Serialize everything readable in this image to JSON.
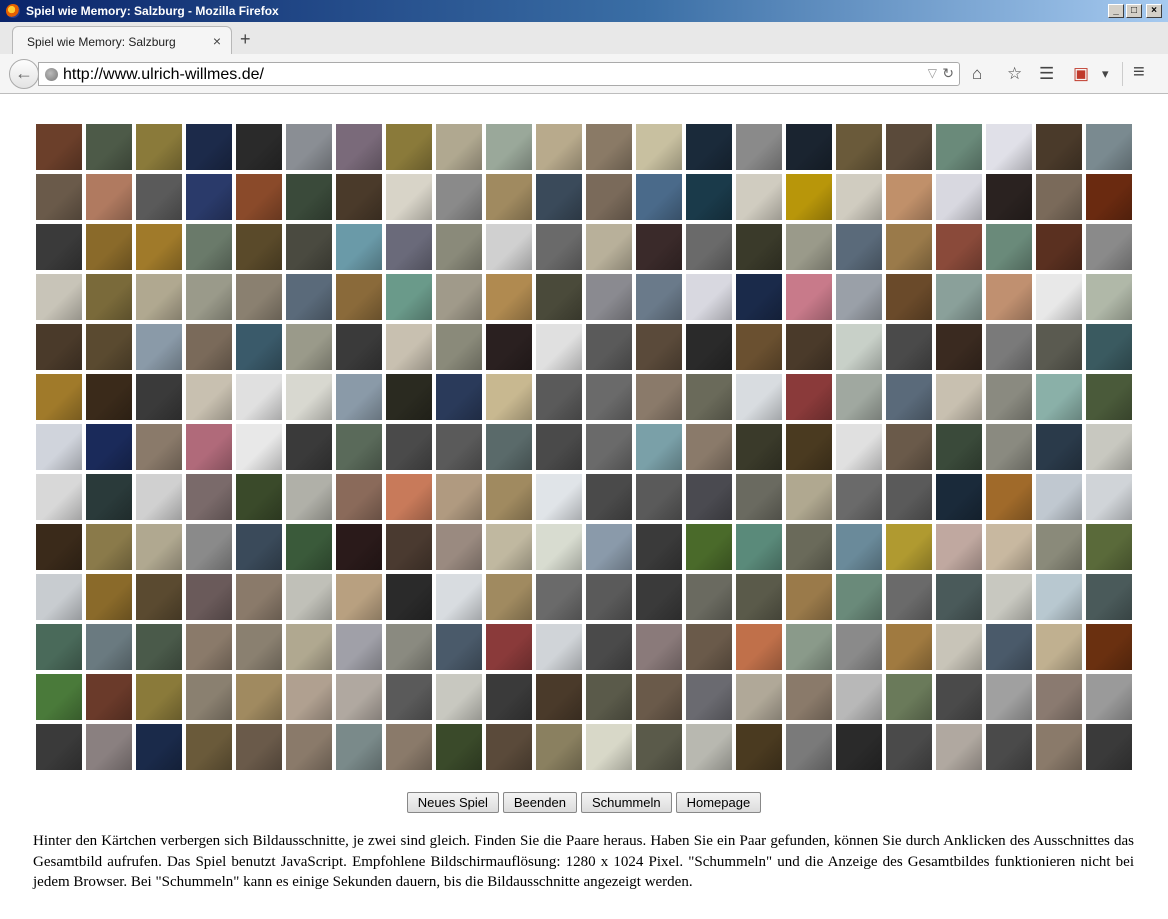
{
  "window": {
    "title": "Spiel wie Memory: Salzburg - Mozilla Firefox",
    "controls": [
      "_",
      "□",
      "×"
    ]
  },
  "tab": {
    "label": "Spiel wie Memory: Salzburg",
    "close": "×",
    "new_tab": "+"
  },
  "navbar": {
    "back": "←",
    "url": "http://www.ulrich-willmes.de/",
    "dropdown": "▽",
    "reload": "↻",
    "icons": {
      "home": "⌂",
      "bookmark": "☆",
      "reading": "☰",
      "pocket": "▣",
      "menu": "≡",
      "more": "▾"
    }
  },
  "game": {
    "columns": 22,
    "rows": 13,
    "tile_colors": [
      "#6b3f2a",
      "#4d5a48",
      "#8a7a3a",
      "#1c2a4a",
      "#2a2a2a",
      "#8a8e94",
      "#7a6a7a",
      "#8a7a3a",
      "#b0a890",
      "#9aa89a",
      "#b8aa8c",
      "#8a7a66",
      "#c8c0a0",
      "#1a2a3a",
      "#8a8a8a",
      "#1a2430",
      "#6a5a3a",
      "#5a4a3a",
      "#6a8a7a",
      "#e0e0e8",
      "#4a3a2a",
      "#7a8a90",
      "#6a5a4a",
      "#b07a60",
      "#5a5a5a",
      "#2a3a6a",
      "#8a4a2a",
      "#3a4a3a",
      "#4a3a2a",
      "#d8d4c8",
      "#8a8a8a",
      "#a08a60",
      "#3a4a5a",
      "#7a6a5a",
      "#4a6a8a",
      "#1a3a4a",
      "#d0ccc0",
      "#b8960a",
      "#d0ccc0",
      "#c0906a",
      "#d8d8e0",
      "#2a2220",
      "#7a6a5a",
      "#6a2a10",
      "#3a3a3a",
      "#8a6a2a",
      "#a07a2a",
      "#6a7a6a",
      "#5a4a2a",
      "#4a4a40",
      "#6a9aa8",
      "#6a6a7a",
      "#8a8a7a",
      "#d0d0d0",
      "#6a6a6a",
      "#b8b09a",
      "#3a2a2a",
      "#6a6a6a",
      "#3a3a2a",
      "#9a9a8a",
      "#5a6a7a",
      "#9a7a4a",
      "#8a4a3a",
      "#6a8a7a",
      "#5a3020",
      "#8a8a8a",
      "#c8c4b8",
      "#7a6a3a",
      "#b0a890",
      "#9a9a8a",
      "#8a8070",
      "#5a6a7a",
      "#8a6a3a",
      "#6a9a8a",
      "#a09a8a",
      "#b08a50",
      "#4a4a3a",
      "#8a8a90",
      "#6a7a8a",
      "#d8d8e0",
      "#1a2a4a",
      "#c87a8a",
      "#9aa0a8",
      "#6a4a2a",
      "#8aa09a",
      "#c09070",
      "#e8e8e8",
      "#b0b8a8",
      "#4a3a2a",
      "#5a4a30",
      "#8a9aa8",
      "#7a6a5a",
      "#3a5a6a",
      "#9a9a8a",
      "#3a3a3a",
      "#c8c0b0",
      "#8a8a7a",
      "#2a2020",
      "#e0e0e0",
      "#5a5a5a",
      "#5a4a3a",
      "#2a2a2a",
      "#6a5030",
      "#4a3a2a",
      "#c8d0c8",
      "#4a4a4a",
      "#3a2a20",
      "#7a7a7a",
      "#5a5a50",
      "#3a5a60",
      "#a07a2a",
      "#3a2a1a",
      "#3a3a3a",
      "#c8c0b0",
      "#e0e0e0",
      "#d8d8d0",
      "#8a9aa8",
      "#2a2a20",
      "#2a3a5a",
      "#c8b890",
      "#5a5a5a",
      "#6a6a6a",
      "#8a7a6a",
      "#6a6a5a",
      "#d8dce0",
      "#8a3a3a",
      "#a0a8a0",
      "#5a6a7a",
      "#c8c0b0",
      "#8a8a80",
      "#8ab0a8",
      "#4a5a3a",
      "#d0d4dc",
      "#1a2a5a",
      "#8a7a6a",
      "#b06a7a",
      "#e8e8e8",
      "#3a3a3a",
      "#5a6a5a",
      "#4a4a4a",
      "#5a5a5a",
      "#5a6a6a",
      "#4a4a4a",
      "#6a6a6a",
      "#7aa0a8",
      "#8a7a6a",
      "#3a3a2a",
      "#4a3a20",
      "#e0e0e0",
      "#6a5a4a",
      "#3a4a3a",
      "#8a8a80",
      "#2a3a4a",
      "#c8c8c0",
      "#d8d8d8",
      "#2a3a3a",
      "#d0d0d0",
      "#7a6a6a",
      "#3a4a2a",
      "#b0b0a8",
      "#8a6a5a",
      "#c87a5a",
      "#b09a80",
      "#a08a60",
      "#e0e4e8",
      "#4a4a4a",
      "#5a5a5a",
      "#4a4a50",
      "#6a6a60",
      "#b0a890",
      "#6a6a6a",
      "#5a5a5a",
      "#1a2a3a",
      "#a06a2a",
      "#c0c8d0",
      "#d0d4d8",
      "#3a2a1a",
      "#8a7a4a",
      "#b0a890",
      "#8a8a8a",
      "#3a4a5a",
      "#3a5a3a",
      "#2a1a1a",
      "#4a3a30",
      "#9a8a80",
      "#c0b8a0",
      "#d8dcd0",
      "#8a9aaa",
      "#3a3a3a",
      "#4a6a2a",
      "#5a8a7a",
      "#6a6a5a",
      "#6a8a9a",
      "#b09a30",
      "#c0a8a0",
      "#c8b8a0",
      "#8a8a7a",
      "#5a6a3a",
      "#c8ccd0",
      "#8a6a2a",
      "#5a4a30",
      "#6a5a5a",
      "#8a7a6a",
      "#c0c0b8",
      "#b8a080",
      "#2a2a2a",
      "#d8dce0",
      "#a08a60",
      "#6a6a6a",
      "#5a5a5a",
      "#3a3a3a",
      "#6a6a60",
      "#5a5a4a",
      "#9a7a4a",
      "#6a8a7a",
      "#6a6a6a",
      "#4a5a5a",
      "#c8c8c0",
      "#b8c8d0",
      "#4a5a5a",
      "#4a6a5a",
      "#6a7a80",
      "#4a5a4a",
      "#8a7a6a",
      "#8a8070",
      "#b0a890",
      "#a0a0a8",
      "#8a8a80",
      "#4a5a6a",
      "#8a3a3a",
      "#d0d4d8",
      "#4a4a4a",
      "#8a7a7a",
      "#6a5a4a",
      "#c0704a",
      "#8a9a8a",
      "#8a8a8a",
      "#a07a40",
      "#c8c4b8",
      "#4a5a6a",
      "#c0b090",
      "#6a3010",
      "#4a7a3a",
      "#6a3a2a",
      "#8a7a3a",
      "#8a8070",
      "#a08a60",
      "#b0a090",
      "#b0a8a0",
      "#5a5a5a",
      "#c8c8c0",
      "#3a3a3a",
      "#4a3a2a",
      "#5a5a4a",
      "#6a5a4a",
      "#6a6a70",
      "#b0a898",
      "#8a7a6a",
      "#b8b8b8",
      "#6a7a5a",
      "#4a4a4a",
      "#a0a0a0",
      "#8a7a70",
      "#9a9a9a",
      "#3a3a3a",
      "#8a8080",
      "#1a2a4a",
      "#6a5a3a",
      "#6a5a4a",
      "#8a7a6a",
      "#7a8a8a",
      "#8a7a6a",
      "#3a4a2a",
      "#5a4a3a",
      "#8a8060",
      "#d8d8c8",
      "#5a5a4a",
      "#b8b8b0",
      "#4a3a20",
      "#7a7a7a",
      "#2a2a2a",
      "#4a4a4a",
      "#b0a8a0",
      "#4a4a4a",
      "#8a7a6a",
      "#3a3a3a"
    ]
  },
  "buttons": {
    "new_game": "Neues Spiel",
    "end": "Beenden",
    "cheat": "Schummeln",
    "homepage": "Homepage"
  },
  "description": "Hinter den Kärtchen verbergen sich Bildausschnitte, je zwei sind gleich. Finden Sie die Paare heraus. Haben Sie ein Paar gefunden, können Sie durch Anklicken des Ausschnittes das Gesamtbild aufrufen. Das Spiel benutzt JavaScript. Empfohlene Bildschirmauflösung: 1280 x 1024 Pixel. \"Schummeln\" und die Anzeige des Gesamtbildes funktionieren nicht bei jedem Browser. Bei \"Schummeln\" kann es einige Sekunden dauern, bis die Bildausschnitte angezeigt werden."
}
